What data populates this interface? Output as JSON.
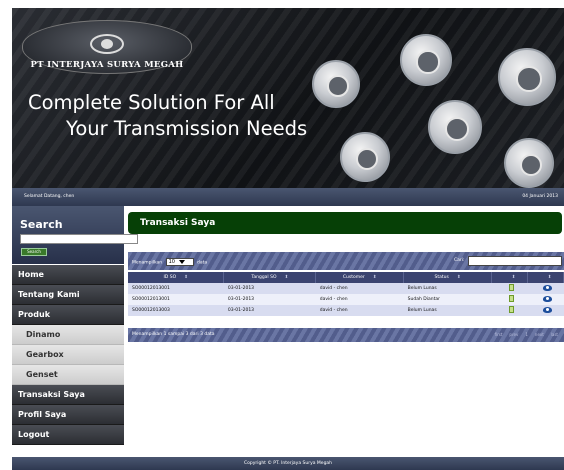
{
  "banner": {
    "company": "PT INTERJAYA SURYA MEGAH",
    "tagline_line1": "Complete Solution For All",
    "tagline_line2": "Your Transmission Needs"
  },
  "infobar": {
    "welcome": "Selamat Datang, chen",
    "date": "04 Januari 2013"
  },
  "sidebar": {
    "search_title": "Search",
    "search_value": "",
    "search_button": "Search",
    "menu": [
      {
        "label": "Home",
        "type": "main"
      },
      {
        "label": "Tentang Kami",
        "type": "main"
      },
      {
        "label": "Produk",
        "type": "main"
      },
      {
        "label": "Dinamo",
        "type": "sub"
      },
      {
        "label": "Gearbox",
        "type": "sub"
      },
      {
        "label": "Genset",
        "type": "sub"
      },
      {
        "label": "Transaksi Saya",
        "type": "main"
      },
      {
        "label": "Profil Saya",
        "type": "main"
      },
      {
        "label": "Logout",
        "type": "main"
      }
    ]
  },
  "main": {
    "title": "Transaksi Saya",
    "show_prefix": "Menampilkan",
    "show_value": "10",
    "show_suffix": "data",
    "find_label": "Cari:",
    "find_value": "",
    "columns": [
      "ID SO",
      "Tanggal SO",
      "Customer",
      "Status",
      "",
      ""
    ],
    "rows": [
      {
        "id": "SO00012013001",
        "date": "03-01-2013",
        "customer": "david - chen",
        "status": "Belum Lunas"
      },
      {
        "id": "SO00012013001",
        "date": "03-01-2013",
        "customer": "david - chen",
        "status": "Sudah Diantar"
      },
      {
        "id": "SO00012013003",
        "date": "03-01-2013",
        "customer": "david - chen",
        "status": "Belum Lunas"
      }
    ],
    "info": "Menampilkan 1 sampai 3 dari 3 data",
    "pager": [
      "first",
      "prev",
      "1",
      "next",
      "last"
    ]
  },
  "footer": {
    "text": "Copyright © PT. Interjaya Surya Megah"
  },
  "icons": {
    "detail": "bill-icon",
    "view": "eye-icon"
  }
}
